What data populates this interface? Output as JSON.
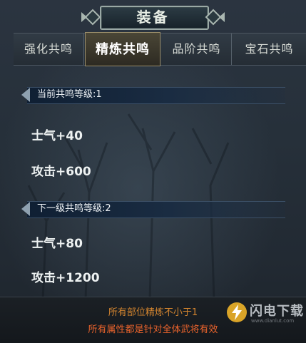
{
  "title": "装备",
  "tabs": [
    {
      "label": "强化共鸣",
      "active": false
    },
    {
      "label": "精炼共鸣",
      "active": true
    },
    {
      "label": "品阶共鸣",
      "active": false
    },
    {
      "label": "宝石共鸣",
      "active": false
    }
  ],
  "current": {
    "header": "当前共鸣等级:1",
    "attrs": [
      "士气+40",
      "攻击+600"
    ]
  },
  "next": {
    "header": "下一级共鸣等级:2",
    "attrs": [
      "士气+80",
      "攻击+1200"
    ]
  },
  "footer": {
    "line1": "所有部位精炼不小于1",
    "line2": "所有属性都是针对全体武将有效"
  },
  "watermark": {
    "text": "闪电下载",
    "url": "www.dianlut.com"
  },
  "colors": {
    "footer_line1": "#d4852f",
    "footer_line2": "#e9632c",
    "watermark_accent": "#f0b429"
  }
}
